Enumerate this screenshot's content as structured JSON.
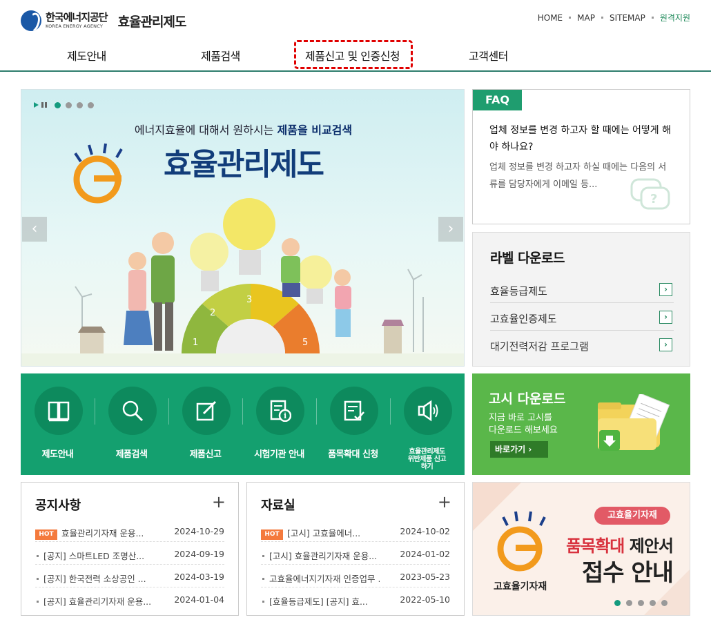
{
  "header": {
    "org_name_ko": "한국에너지공단",
    "org_name_en": "KOREA ENERGY AGENCY",
    "site_title": "효율관리제도",
    "util": [
      "HOME",
      "MAP",
      "SITEMAP",
      "원격지원"
    ]
  },
  "gnb": [
    "제도안내",
    "제품검색",
    "제품신고 및 인증신청",
    "고객센터"
  ],
  "hero": {
    "tagline_pre": "에너지효율에 대해서 원하시는 ",
    "tagline_bold": "제품을 비교검색",
    "title": "효율관리제도",
    "grades": [
      "1",
      "2",
      "3",
      "5"
    ],
    "slide_count": 4,
    "active_slide": 1,
    "prev_label": "‹",
    "next_label": "›"
  },
  "faq": {
    "tag": "FAQ",
    "question": "업체 정보를 변경 하고자 할 때에는 어떻게 해야 하나요?",
    "answer": "업체 정보를 변경 하고자 하실 때에는 다음의 서류를 담당자에게 이메일 등..."
  },
  "labels": {
    "title": "라벨 다운로드",
    "items": [
      "효율등급제도",
      "고효율인증제도",
      "대기전력저감 프로그램"
    ]
  },
  "quick": {
    "items": [
      {
        "label": "제도안내",
        "icon": "book-icon"
      },
      {
        "label": "제품검색",
        "icon": "search-icon"
      },
      {
        "label": "제품신고",
        "icon": "edit-icon"
      },
      {
        "label": "시험기관 안내",
        "icon": "document-info-icon"
      },
      {
        "label": "품목확대 신청",
        "icon": "checklist-icon"
      },
      {
        "label": "효율관리제도 위반제품 신고하기",
        "icon": "megaphone-icon"
      }
    ]
  },
  "gosi": {
    "title": "고시 다운로드",
    "desc1": "지금 바로 고시를",
    "desc2": "다운로드 해보세요",
    "button": "바로가기 ›"
  },
  "notice": {
    "title": "공지사항",
    "plus": "+",
    "rows": [
      {
        "hot": true,
        "text": "효율관리기자재 운용...",
        "date": "2024-10-29"
      },
      {
        "hot": false,
        "text": "[공지] 스마트LED 조명산...",
        "date": "2024-09-19"
      },
      {
        "hot": false,
        "text": "[공지] 한국전력 소상공인 ...",
        "date": "2024-03-19"
      },
      {
        "hot": false,
        "text": "[공지] 효율관리기자재 운용...",
        "date": "2024-01-04"
      }
    ]
  },
  "archive": {
    "title": "자료실",
    "plus": "+",
    "rows": [
      {
        "hot": true,
        "text": "[고시] 고효율에너...",
        "date": "2024-10-02"
      },
      {
        "hot": false,
        "text": "[고시] 효율관리기자재 운용...",
        "date": "2024-01-02"
      },
      {
        "hot": false,
        "text": "고효율에너지기자재 인증업무 ...",
        "date": "2023-05-23"
      },
      {
        "hot": false,
        "text": "[효율등급제도] [공지] 효...",
        "date": "2022-05-10"
      }
    ]
  },
  "banner": {
    "pill": "고효율기자재",
    "line1_hl": "품목확대",
    "line1_rest": " 제안서",
    "line2": "접수 안내",
    "caption": "고효율기자재",
    "slide_count": 5,
    "active_slide": 1
  },
  "hot_label": "HOT",
  "colors": {
    "brand_green": "#14a06f",
    "highlight": "#e00000",
    "hot": "#f47a3d",
    "gosi_green": "#5ab74a"
  }
}
